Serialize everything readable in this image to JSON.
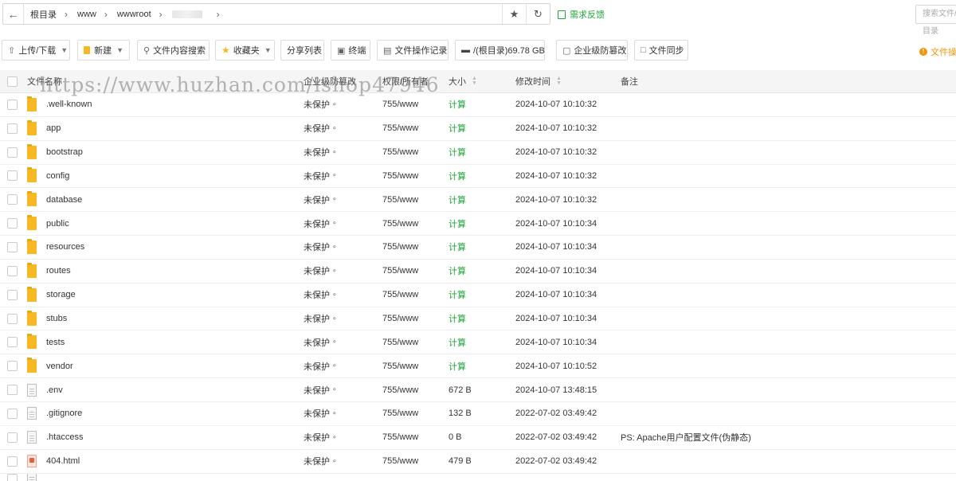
{
  "pathbar": {
    "crumbs": [
      "根目录",
      "www",
      "wwwroot"
    ],
    "feedback_label": "需求反馈",
    "search_placeholder": "搜索文件/目录"
  },
  "toolbar": {
    "upload_label": "上传/下载",
    "new_label": "新建",
    "content_search_label": "文件内容搜索",
    "favorites_label": "收藏夹",
    "share_list_label": "分享列表",
    "terminal_label": "终端",
    "oplog_label": "文件操作记录",
    "disk_label": "/(根目录)69.78 GB",
    "tamper_label": "企业级防篡改",
    "sync_label": "文件同步",
    "right_label": "文件操作"
  },
  "table": {
    "headers": {
      "name": "文件名称",
      "protect": "企业级防篡改",
      "perm": "权限/所有者",
      "size": "大小",
      "mtime": "修改时间",
      "note": "备注"
    },
    "rows": [
      {
        "type": "folder",
        "name": ".well-known",
        "protect": "未保护",
        "perm": "755/www",
        "size": "计算",
        "mtime": "2024-10-07 10:10:32",
        "note": ""
      },
      {
        "type": "folder",
        "name": "app",
        "protect": "未保护",
        "perm": "755/www",
        "size": "计算",
        "mtime": "2024-10-07 10:10:32",
        "note": ""
      },
      {
        "type": "folder",
        "name": "bootstrap",
        "protect": "未保护",
        "perm": "755/www",
        "size": "计算",
        "mtime": "2024-10-07 10:10:32",
        "note": ""
      },
      {
        "type": "folder",
        "name": "config",
        "protect": "未保护",
        "perm": "755/www",
        "size": "计算",
        "mtime": "2024-10-07 10:10:32",
        "note": ""
      },
      {
        "type": "folder",
        "name": "database",
        "protect": "未保护",
        "perm": "755/www",
        "size": "计算",
        "mtime": "2024-10-07 10:10:32",
        "note": ""
      },
      {
        "type": "folder",
        "name": "public",
        "protect": "未保护",
        "perm": "755/www",
        "size": "计算",
        "mtime": "2024-10-07 10:10:34",
        "note": ""
      },
      {
        "type": "folder",
        "name": "resources",
        "protect": "未保护",
        "perm": "755/www",
        "size": "计算",
        "mtime": "2024-10-07 10:10:34",
        "note": ""
      },
      {
        "type": "folder",
        "name": "routes",
        "protect": "未保护",
        "perm": "755/www",
        "size": "计算",
        "mtime": "2024-10-07 10:10:34",
        "note": ""
      },
      {
        "type": "folder",
        "name": "storage",
        "protect": "未保护",
        "perm": "755/www",
        "size": "计算",
        "mtime": "2024-10-07 10:10:34",
        "note": ""
      },
      {
        "type": "folder",
        "name": "stubs",
        "protect": "未保护",
        "perm": "755/www",
        "size": "计算",
        "mtime": "2024-10-07 10:10:34",
        "note": ""
      },
      {
        "type": "folder",
        "name": "tests",
        "protect": "未保护",
        "perm": "755/www",
        "size": "计算",
        "mtime": "2024-10-07 10:10:34",
        "note": ""
      },
      {
        "type": "folder",
        "name": "vendor",
        "protect": "未保护",
        "perm": "755/www",
        "size": "计算",
        "mtime": "2024-10-07 10:10:52",
        "note": ""
      },
      {
        "type": "file",
        "name": ".env",
        "protect": "未保护",
        "perm": "755/www",
        "size": "672 B",
        "mtime": "2024-10-07 13:48:15",
        "note": ""
      },
      {
        "type": "file",
        "name": ".gitignore",
        "protect": "未保护",
        "perm": "755/www",
        "size": "132 B",
        "mtime": "2022-07-02 03:49:42",
        "note": ""
      },
      {
        "type": "file",
        "name": ".htaccess",
        "protect": "未保护",
        "perm": "755/www",
        "size": "0 B",
        "mtime": "2022-07-02 03:49:42",
        "note": "PS: Apache用户配置文件(伪静态)"
      },
      {
        "type": "html",
        "name": "404.html",
        "protect": "未保护",
        "perm": "755/www",
        "size": "479 B",
        "mtime": "2022-07-02 03:49:42",
        "note": ""
      }
    ]
  },
  "watermark": "https://www.huzhan.com/ishop47946",
  "colors": {
    "accent": "#20a53a",
    "folder": "#f7b923",
    "warn": "#f0950c"
  }
}
